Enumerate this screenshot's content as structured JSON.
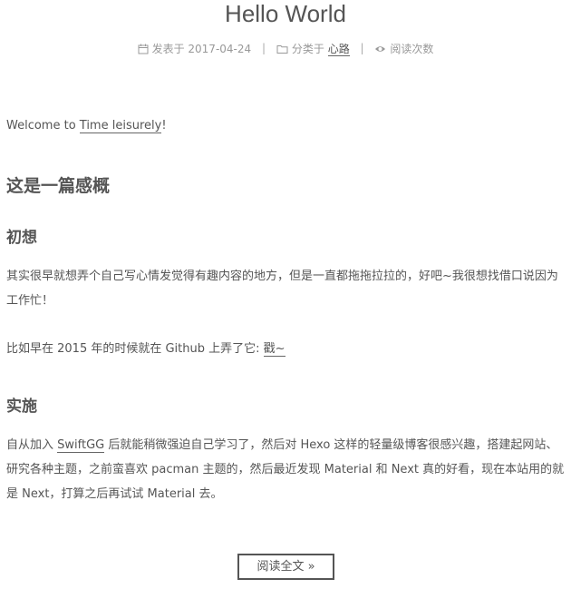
{
  "post": {
    "title": "Hello World",
    "meta": {
      "posted_label": "发表于",
      "posted_date": "2017-04-24",
      "separator": "|",
      "category_label": "分类于",
      "category": "心路",
      "views_label": "阅读次数",
      "icons": [
        "calendar-icon",
        "folder-icon",
        "eye-icon"
      ]
    },
    "intro": {
      "before": "Welcome to ",
      "link": "Time leisurely",
      "after": "!"
    },
    "heading_main": "这是一篇感概",
    "section1": {
      "heading": "初想",
      "para1": "其实很早就想弄个自己写心情发觉得有趣内容的地方，但是一直都拖拖拉拉的，好吧~我很想找借口说因为工作忙！",
      "para2_before": "比如早在 2015 年的时候就在 Github 上弄了它: ",
      "para2_link": "戳~"
    },
    "section2": {
      "heading": "实施",
      "para_before": "自从加入 ",
      "para_link": "SwiftGG",
      "para_after": " 后就能稍微强迫自己学习了，然后对 Hexo 这样的轻量级博客很感兴趣，搭建起网站、研究各种主题，之前蛮喜欢 pacman 主题的，然后最近发现 Material 和 Next 真的好看，现在本站用的就是 Next，打算之后再试试 Material 去。"
    },
    "read_more": "阅读全文 »"
  }
}
